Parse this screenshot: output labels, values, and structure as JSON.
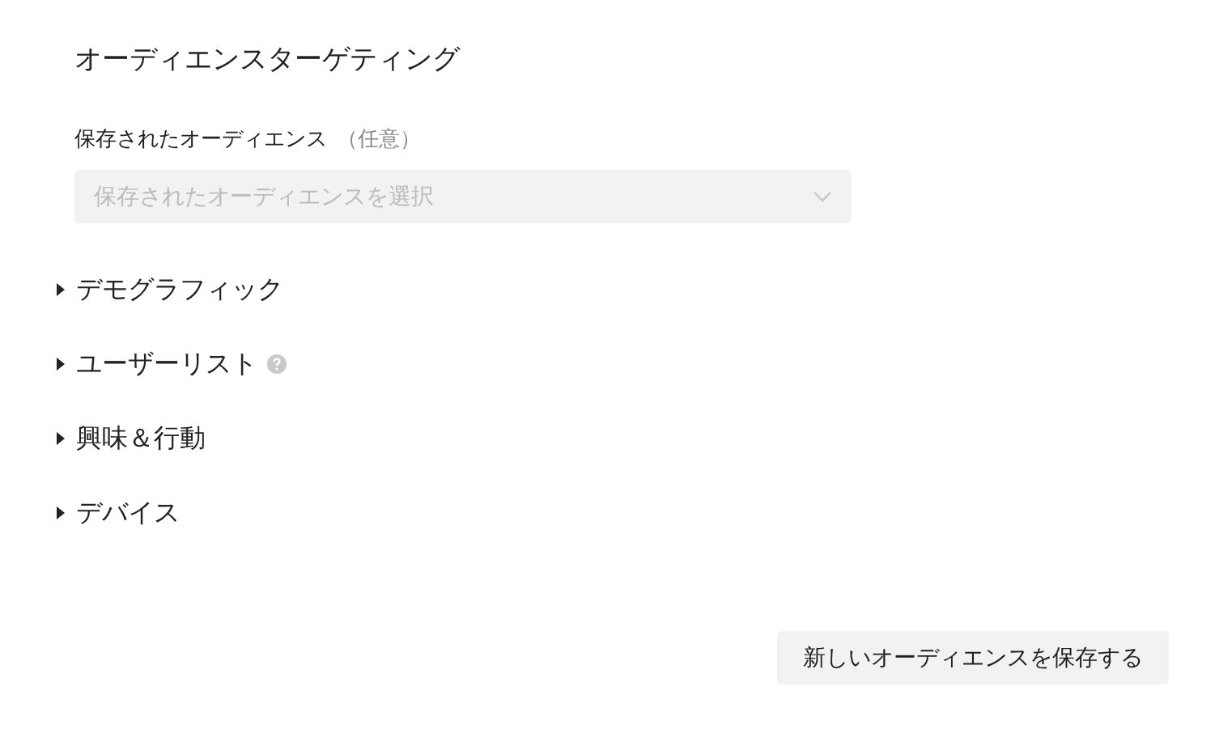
{
  "title": "オーディエンスターゲティング",
  "saved_audience": {
    "label": "保存されたオーディエンス",
    "optional_note": "（任意）",
    "placeholder": "保存されたオーディエンスを選択",
    "disabled": true
  },
  "sections": [
    {
      "label": "デモグラフィック",
      "expanded": false,
      "has_help": false
    },
    {
      "label": "ユーザーリスト",
      "expanded": false,
      "has_help": true
    },
    {
      "label": "興味＆行動",
      "expanded": false,
      "has_help": false
    },
    {
      "label": "デバイス",
      "expanded": false,
      "has_help": false
    }
  ],
  "save_button": "新しいオーディエンスを保存する"
}
